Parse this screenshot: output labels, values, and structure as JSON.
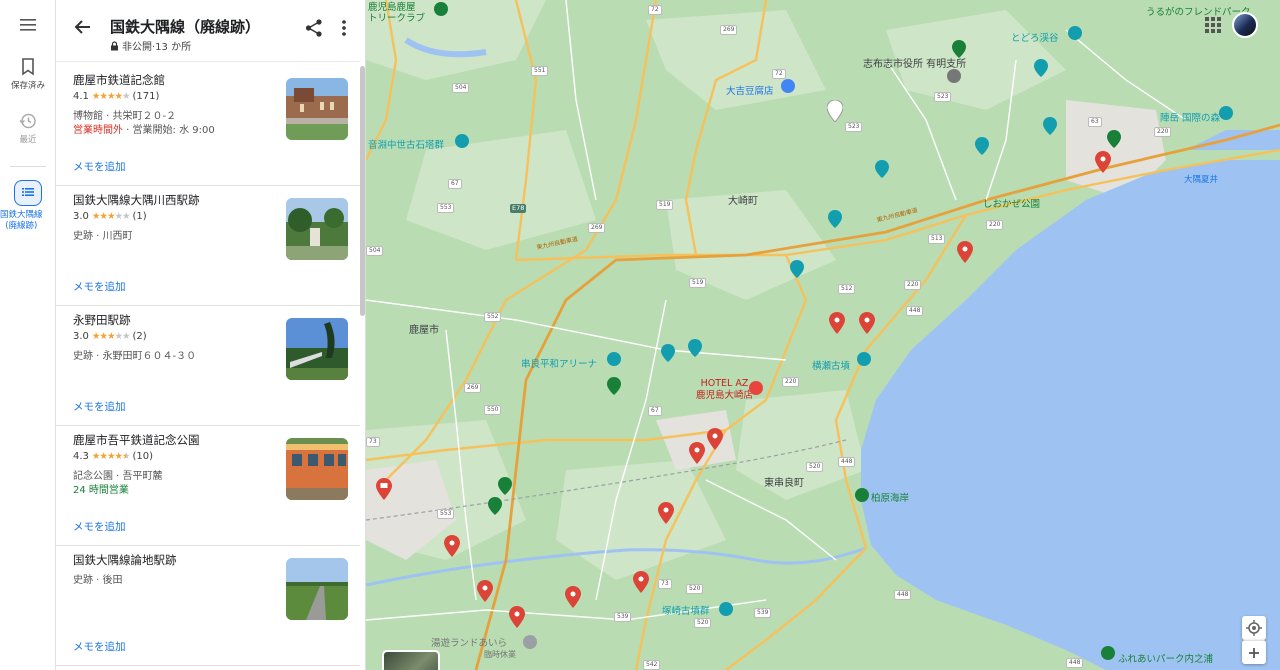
{
  "rail": {
    "saved_label": "保存済み",
    "recent_label": "最近",
    "list_label": "国鉄大隅線\n(廃線跡)"
  },
  "list": {
    "title": "国鉄大隅線（廃線跡）",
    "subtitle": "非公開·13 か所",
    "memo_label": "メモを追加",
    "items": [
      {
        "name": "鹿屋市鉄道記念館",
        "rating": "4.1",
        "stars": 4,
        "reviews": "(171)",
        "meta": "博物館 · 共栄町２０-２",
        "status_closed": "営業時間外",
        "status_rest": " · 営業開始: 水 9:00",
        "memo": "メモを追加"
      },
      {
        "name": "国鉄大隅線大隅川西駅跡",
        "rating": "3.0",
        "stars": 3,
        "reviews": "(1)",
        "meta": "史跡 · 川西町",
        "memo": "メモを追加"
      },
      {
        "name": "永野田駅跡",
        "rating": "3.0",
        "stars": 3,
        "reviews": "(2)",
        "meta": "史跡 · 永野田町６０４-３０",
        "memo": "メモを追加"
      },
      {
        "name": "鹿屋市吾平鉄道記念公園",
        "rating": "4.3",
        "stars": 4.5,
        "reviews": "(10)",
        "meta": "記念公園 · 吾平町麓",
        "status_open": "24 時間営業",
        "memo": "メモを追加"
      },
      {
        "name": "国鉄大隅線論地駅跡",
        "meta": "史跡 · 後田",
        "memo": "メモを追加"
      }
    ]
  },
  "map": {
    "labels": {
      "kanoya_airport": "鹿児島鹿屋\nトリークラブ",
      "ururaga": "うるがのフレンドパーク",
      "todoro": "とどろ渓谷",
      "shibushi_office": "志布志市役所 有明支所",
      "okichi": "大吉豆腐店",
      "ongaku": "音淵中世古石塔群",
      "youdake": "陣岳 国際の森",
      "osumi_natsui": "大隅夏井",
      "osaki_town": "大崎町",
      "shiokaze": "しおかぜ公園",
      "kanoya_city": "鹿屋市",
      "kushira_arena": "串良平和アリーナ",
      "yokose": "横瀬古墳",
      "hotel_az": "HOTEL AZ\n鹿児島大崎店",
      "higashikushira": "東串良町",
      "kashiwabaru": "柏原海岸",
      "tsukazaki": "塚崎古墳群",
      "yuyu_land": "湯遊ランドあいら",
      "yuyu_note": "臨時休業",
      "fureai": "ふれあいパーク内之浦",
      "expressway": "東九州自動車道"
    }
  }
}
